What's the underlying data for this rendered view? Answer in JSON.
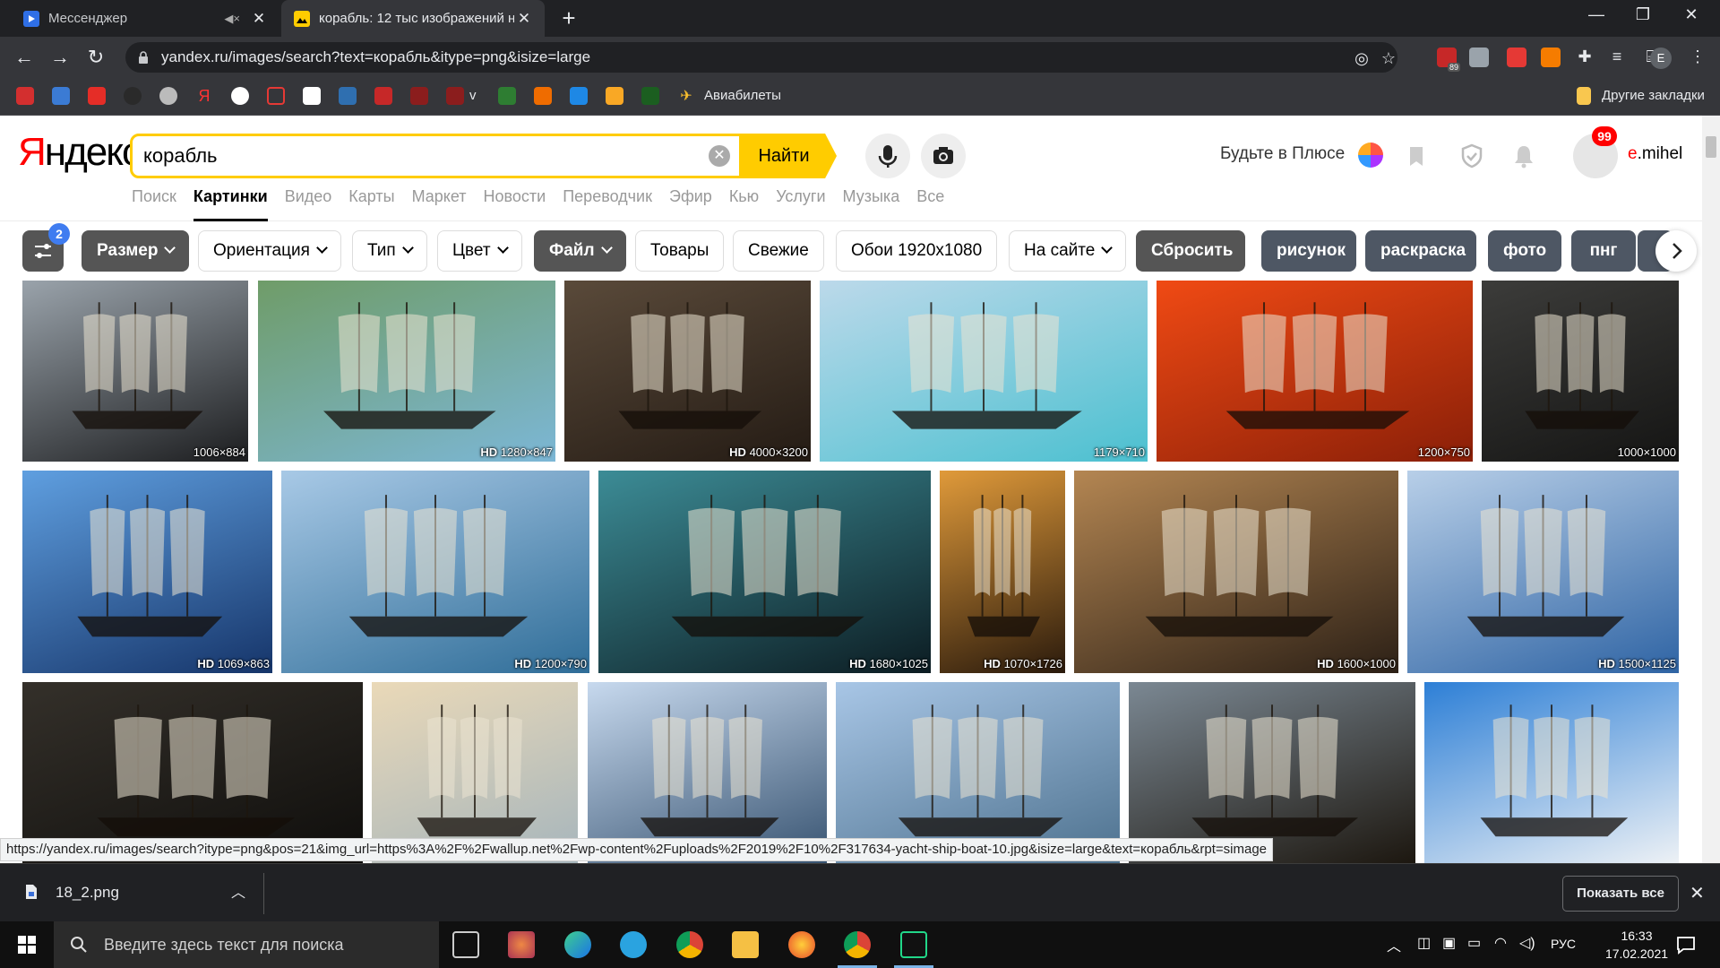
{
  "browser": {
    "tabs": [
      {
        "title": "Мессенджер",
        "active": false
      },
      {
        "title": "корабль: 12 тыс изображений н",
        "active": true
      }
    ],
    "url": "yandex.ru/images/search?text=корабль&itype=png&isize=large",
    "extensions_badge": "89",
    "profile_initial": "E",
    "bookmarks_visible_label": "Авиабилеты",
    "bookmark_letter": "v",
    "other_bookmarks": "Другие закладки"
  },
  "yandex": {
    "logo_ya": "Я",
    "logo_rest": "ндекс",
    "search_query": "корабль",
    "find_button": "Найти",
    "plus_text": "Будьте в Плюсе",
    "notifications_badge": "99",
    "user_first": "e",
    "user_rest": ".mihel",
    "services": [
      "Поиск",
      "Картинки",
      "Видео",
      "Карты",
      "Маркет",
      "Новости",
      "Переводчик",
      "Эфир",
      "Кью",
      "Услуги",
      "Музыка",
      "Все"
    ],
    "active_service": "Картинки"
  },
  "filters": {
    "settings_badge": "2",
    "size": "Размер",
    "orientation": "Ориентация",
    "type": "Тип",
    "color": "Цвет",
    "file": "Файл",
    "goods": "Товары",
    "fresh": "Свежие",
    "wallpaper": "Обои 1920x1080",
    "on_site": "На сайте",
    "reset": "Сбросить",
    "suggestions": [
      "рисунок",
      "раскраска",
      "фото",
      "пнг"
    ]
  },
  "images": [
    {
      "hd": "",
      "size": "1006×884",
      "colors": [
        "#9aa3ab",
        "#1c1d1f"
      ]
    },
    {
      "hd": "HD",
      "size": "1280×847",
      "colors": [
        "#6f9c68",
        "#7cb7d6"
      ]
    },
    {
      "hd": "HD",
      "size": "4000×3200",
      "colors": [
        "#5a4a3a",
        "#241b14"
      ]
    },
    {
      "hd": "",
      "size": "1179×710",
      "colors": [
        "#bcd9ea",
        "#4bc0d0"
      ]
    },
    {
      "hd": "",
      "size": "1200×750",
      "colors": [
        "#f04a14",
        "#8a1f08"
      ]
    },
    {
      "hd": "",
      "size": "1000×1000",
      "colors": [
        "#3c3c3a",
        "#151514"
      ]
    },
    {
      "hd": "HD",
      "size": "1069×863",
      "colors": [
        "#5f9fe0",
        "#16356a"
      ]
    },
    {
      "hd": "HD",
      "size": "1200×790",
      "colors": [
        "#a8c9e6",
        "#2f6d98"
      ]
    },
    {
      "hd": "HD",
      "size": "1680×1025",
      "colors": [
        "#3c8c96",
        "#0c1c22"
      ]
    },
    {
      "hd": "HD",
      "size": "1070×1726",
      "colors": [
        "#e09a3a",
        "#2a1a0c"
      ]
    },
    {
      "hd": "HD",
      "size": "1600×1000",
      "colors": [
        "#b48652",
        "#2c2016"
      ]
    },
    {
      "hd": "HD",
      "size": "1500×1125",
      "colors": [
        "#b8cfe8",
        "#2f64a4"
      ]
    },
    {
      "hd": "",
      "size": "",
      "colors": [
        "#34302a",
        "#0e0d0b"
      ]
    },
    {
      "hd": "",
      "size": "",
      "colors": [
        "#ead9b8",
        "#a4b4bc"
      ]
    },
    {
      "hd": "",
      "size": "",
      "colors": [
        "#c7d9ee",
        "#34506e"
      ]
    },
    {
      "hd": "",
      "size": "",
      "colors": [
        "#a8c6e6",
        "#4b6f8c"
      ]
    },
    {
      "hd": "",
      "size": "",
      "colors": [
        "#7b8893",
        "#1a140c"
      ]
    },
    {
      "hd": "",
      "size": "",
      "colors": [
        "#2d7fd6",
        "#f2f4f6"
      ]
    }
  ],
  "status_url": "https://yandex.ru/images/search?itype=png&pos=21&img_url=https%3A%2F%2Fwallup.net%2Fwp-content%2Fuploads%2F2019%2F10%2F317634-yacht-ship-boat-10.jpg&isize=large&text=корабль&rpt=simage",
  "downloads": {
    "file": "18_2.png",
    "show_all": "Показать все"
  },
  "taskbar": {
    "search_placeholder": "Введите здесь текст для поиска",
    "lang": "РУС",
    "time": "16:33",
    "date": "17.02.2021"
  },
  "colors": {
    "yandex_yellow": "#ffcc00",
    "yandex_red": "#ff0000",
    "chrome_dark": "#202124"
  }
}
